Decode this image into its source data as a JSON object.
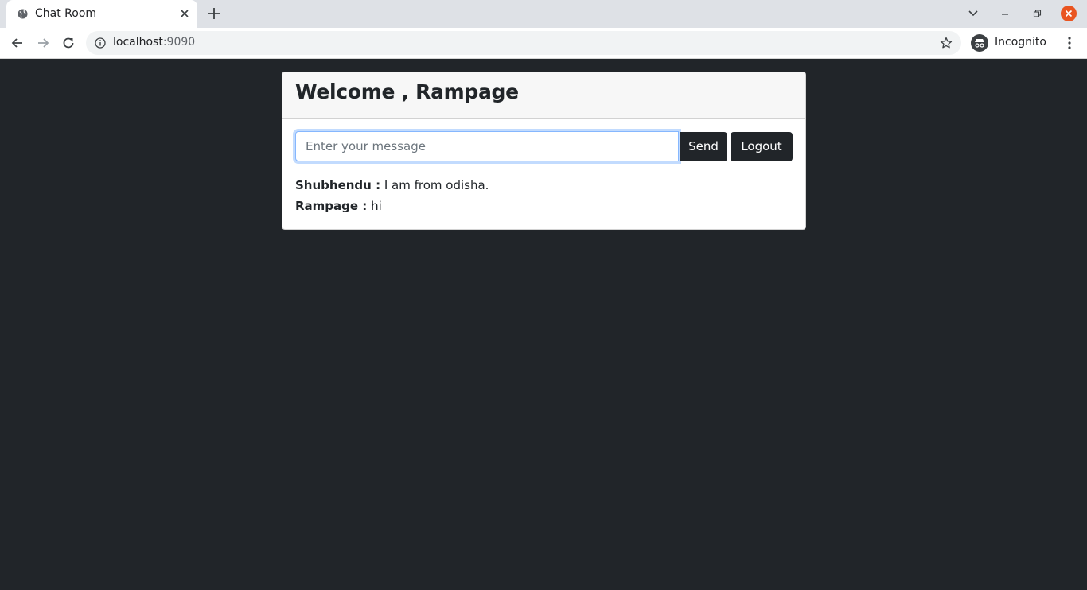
{
  "browser": {
    "tab_title": "Chat Room",
    "url_host": "localhost",
    "url_port": ":9090",
    "profile_label": "Incognito"
  },
  "chat": {
    "welcome_title": "Welcome , Rampage",
    "input_placeholder": "Enter your message",
    "input_value": "",
    "send_label": "Send",
    "logout_label": "Logout",
    "messages": [
      {
        "sender": "Shubhendu :",
        "text": " I am from odisha."
      },
      {
        "sender": "Rampage :",
        "text": " hi"
      }
    ]
  },
  "colors": {
    "page_background": "#212529",
    "button_background": "#212529",
    "focus_ring": "#86b7fe",
    "window_close": "#e95420"
  }
}
